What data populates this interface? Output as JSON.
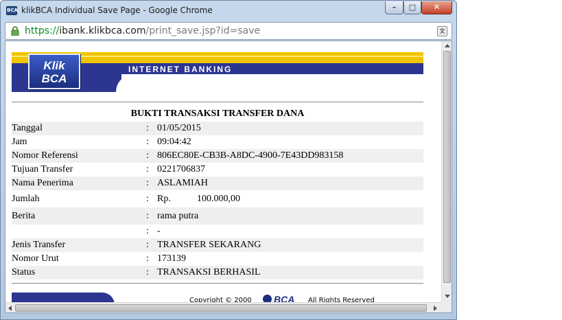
{
  "window": {
    "title": "klikBCA Individual Save Page - Google Chrome",
    "app_icon_text": "BCA",
    "minimize_label": "–",
    "maximize_label": "□",
    "close_label": "✕"
  },
  "address": {
    "scheme": "https://",
    "host": "ibank.klikbca.com",
    "path": "/print_save.jsp?id=save",
    "lock_icon": "lock-icon",
    "translate_icon": "translate-icon"
  },
  "banner": {
    "logo_line1": "Klik",
    "logo_line2": "BCA",
    "title": "INTERNET BANKING",
    "colors": {
      "gold": "#f0c400",
      "navy": "#2c3690"
    }
  },
  "receipt": {
    "title": "BUKTI TRANSAKSI TRANSFER DANA",
    "separator": ":",
    "rows": [
      {
        "label": "Tanggal",
        "value": "01/05/2015"
      },
      {
        "label": "Jam",
        "value": "09:04:42"
      },
      {
        "label": "Nomor Referensi",
        "value": "806EC80E-CB3B-A8DC-4900-7E43DD983158"
      },
      {
        "label": "Tujuan Transfer",
        "value": "0221706837"
      },
      {
        "label": "Nama Penerima",
        "value": "ASLAMIAH"
      },
      {
        "label": "Jumlah",
        "currency": "Rp.",
        "value": "100.000,00"
      },
      {
        "label": "Berita",
        "value": "rama putra"
      },
      {
        "label": "",
        "value": "-"
      },
      {
        "label": "Jenis Transfer",
        "value": "TRANSFER SEKARANG"
      },
      {
        "label": "Nomor Urut",
        "value": "173139"
      },
      {
        "label": "Status",
        "value": "TRANSAKSI BERHASIL"
      }
    ]
  },
  "footer": {
    "copyright": "Copyright © 2000",
    "logo_text": "BCA",
    "rights": "All Rights Reserved"
  }
}
